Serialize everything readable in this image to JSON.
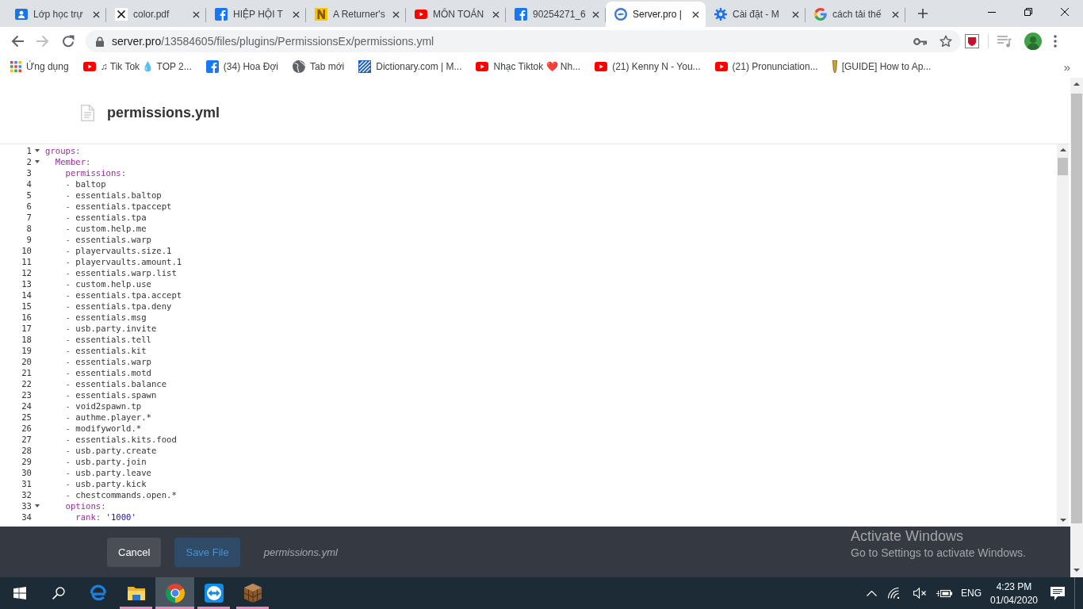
{
  "browser": {
    "tabs": [
      {
        "kind": "person",
        "title": "Lớp học trự",
        "selected": false
      },
      {
        "kind": "tex",
        "title": "color.pdf",
        "selected": false
      },
      {
        "kind": "flogo",
        "title": "HIỆP HỘI T",
        "selected": false
      },
      {
        "kind": "nletter",
        "title": "A Returner's",
        "selected": false
      },
      {
        "kind": "play",
        "title": "MÔN TOÁN",
        "selected": false
      },
      {
        "kind": "flogo",
        "title": "90254271_6",
        "selected": false
      },
      {
        "kind": "eye",
        "title": "Server.pro |",
        "selected": true
      },
      {
        "kind": "gear",
        "title": "Cài đặt - M",
        "selected": false
      },
      {
        "kind": "glogo",
        "title": "cách tải thế",
        "selected": false
      }
    ],
    "nav_buttons": [
      {
        "kind": "back",
        "disabled": false
      },
      {
        "kind": "forward",
        "disabled": true
      },
      {
        "kind": "reload",
        "disabled": false
      }
    ],
    "address": {
      "host": "server.pro",
      "path": "/13584605/files/plugins/PermissionsEx/permissions.yml"
    },
    "bookmarks": [
      {
        "kind": "grid",
        "label": "Ứng dụng"
      },
      {
        "kind": "play",
        "label": "♫ Tik Tok 💧 TOP 2..."
      },
      {
        "kind": "flogo",
        "label": "(34) Hoa Đợi"
      },
      {
        "kind": "globe",
        "label": "Tab mới"
      },
      {
        "kind": "dictionary",
        "label": "Dictionary.com | M..."
      },
      {
        "kind": "play",
        "label": "Nhạc Tiktok ❤️ Nh..."
      },
      {
        "kind": "play",
        "label": "(21) Kenny N - You..."
      },
      {
        "kind": "play",
        "label": "(21) Pronunciation..."
      },
      {
        "kind": "quill",
        "label": "[GUIDE] How to Ap..."
      }
    ],
    "bookmarks_overflow": "»"
  },
  "page": {
    "title": "permissions.yml",
    "editor": {
      "lines": [
        {
          "number": "1",
          "kind": "key",
          "key": "groups:",
          "expanded": true,
          "children": [
            {
              "number": "2",
              "kind": "key",
              "key": "Member:",
              "expanded": true,
              "children": [
                {
                  "number": "3",
                  "kind": "key",
                  "key": "permissions:",
                  "children": [
                    {
                      "number": "4",
                      "kind": "item",
                      "marker": "-",
                      "text": "baltop"
                    },
                    {
                      "number": "5",
                      "kind": "item",
                      "marker": "-",
                      "text": "essentials.baltop"
                    },
                    {
                      "number": "6",
                      "kind": "item",
                      "marker": "-",
                      "text": "essentials.tpaccept"
                    },
                    {
                      "number": "7",
                      "kind": "item",
                      "marker": "-",
                      "text": "essentials.tpa"
                    },
                    {
                      "number": "8",
                      "kind": "item",
                      "marker": "-",
                      "text": "custom.help.me"
                    },
                    {
                      "number": "9",
                      "kind": "item",
                      "marker": "-",
                      "text": "essentials.warp"
                    },
                    {
                      "number": "10",
                      "kind": "item",
                      "marker": "-",
                      "text": "playervaults.size.1"
                    },
                    {
                      "number": "11",
                      "kind": "item",
                      "marker": "-",
                      "text": "playervaults.amount.1"
                    },
                    {
                      "number": "12",
                      "kind": "item",
                      "marker": "-",
                      "text": "essentials.warp.list"
                    },
                    {
                      "number": "13",
                      "kind": "item",
                      "marker": "-",
                      "text": "custom.help.use"
                    },
                    {
                      "number": "14",
                      "kind": "item",
                      "marker": "-",
                      "text": "essentials.tpa.accept"
                    },
                    {
                      "number": "15",
                      "kind": "item",
                      "marker": "-",
                      "text": "essentials.tpa.deny"
                    },
                    {
                      "number": "16",
                      "kind": "item",
                      "marker": "-",
                      "text": "essentials.msg"
                    },
                    {
                      "number": "17",
                      "kind": "item",
                      "marker": "-",
                      "text": "usb.party.invite"
                    },
                    {
                      "number": "18",
                      "kind": "item",
                      "marker": "-",
                      "text": "essentials.tell"
                    },
                    {
                      "number": "19",
                      "kind": "item",
                      "marker": "-",
                      "text": "essentials.kit"
                    },
                    {
                      "number": "20",
                      "kind": "item",
                      "marker": "-",
                      "text": "essentials.warp"
                    },
                    {
                      "number": "21",
                      "kind": "item",
                      "marker": "-",
                      "text": "essentials.motd"
                    },
                    {
                      "number": "22",
                      "kind": "item",
                      "marker": "-",
                      "text": "essentials.balance"
                    },
                    {
                      "number": "23",
                      "kind": "item",
                      "marker": "-",
                      "text": "essentials.spawn"
                    },
                    {
                      "number": "24",
                      "kind": "item",
                      "marker": "-",
                      "text": "void2spawn.tp"
                    },
                    {
                      "number": "25",
                      "kind": "item",
                      "marker": "-",
                      "text": "authme.player.*"
                    },
                    {
                      "number": "26",
                      "kind": "item",
                      "marker": "-",
                      "text": "modifyworld.*"
                    },
                    {
                      "number": "27",
                      "kind": "item",
                      "marker": "-",
                      "text": "essentials.kits.food"
                    },
                    {
                      "number": "28",
                      "kind": "item",
                      "marker": "-",
                      "text": "usb.party.create"
                    },
                    {
                      "number": "29",
                      "kind": "item",
                      "marker": "-",
                      "text": "usb.party.join"
                    },
                    {
                      "number": "30",
                      "kind": "item",
                      "marker": "-",
                      "text": "usb.party.leave"
                    },
                    {
                      "number": "31",
                      "kind": "item",
                      "marker": "-",
                      "text": "usb.party.kick"
                    },
                    {
                      "number": "32",
                      "kind": "item",
                      "marker": "-",
                      "text": "chestcommands.open.*"
                    }
                  ]
                },
                {
                  "number": "33",
                  "kind": "key",
                  "key": "options:",
                  "expanded": true,
                  "children": [
                    {
                      "number": "34",
                      "kind": "key",
                      "key": "rank:",
                      "value": "'1000'"
                    }
                  ]
                }
              ]
            }
          ]
        }
      ]
    },
    "footer": {
      "buttons": [
        {
          "kind": "secondary",
          "label": "Cancel",
          "disabled": false
        },
        {
          "kind": "primary",
          "label": "Save File",
          "disabled": true
        }
      ],
      "filename": "permissions.yml"
    }
  },
  "activation_notice": {
    "title": "Activate Windows",
    "message": "Go to Settings to activate Windows."
  },
  "taskbar": {
    "apps": [
      {
        "kind": "elogo",
        "running": false,
        "selected": false
      },
      {
        "kind": "folder",
        "running": true,
        "selected": false
      },
      {
        "kind": "wheel",
        "running": true,
        "selected": true
      },
      {
        "kind": "arrows",
        "running": true,
        "selected": false
      },
      {
        "kind": "crate",
        "running": true,
        "selected": false
      }
    ],
    "tray": {
      "muted": true,
      "language": "ENG",
      "time": "4:23 PM",
      "date": "01/04/2020"
    }
  }
}
